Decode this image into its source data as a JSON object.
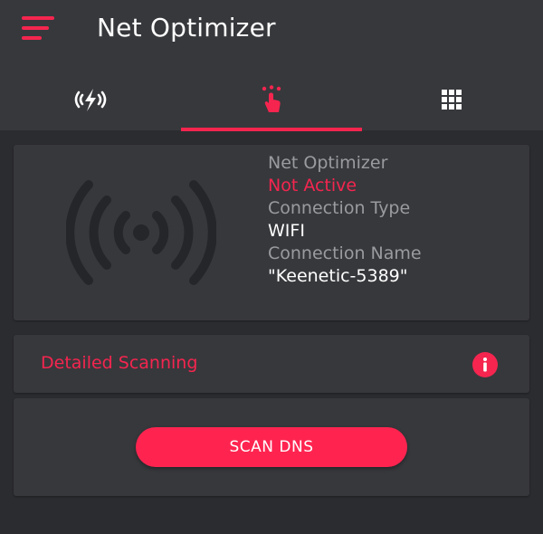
{
  "app": {
    "title": "Net Optimizer",
    "accent_color": "#f5254f"
  },
  "header": {
    "menu_icon": "hamburger-menu-icon",
    "tabs": [
      {
        "icon": "broadcast-lightning-icon",
        "selected": false
      },
      {
        "icon": "touch-tap-icon",
        "selected": true
      },
      {
        "icon": "grid-icon",
        "selected": false
      }
    ]
  },
  "status_card": {
    "icon": "wifi-signal-icon",
    "optimizer_label": "Net Optimizer",
    "optimizer_status": "Not Active",
    "connection_type_label": "Connection Type",
    "connection_type_value": "WIFI",
    "connection_name_label": "Connection Name",
    "connection_name_value": "\"Keenetic-5389\""
  },
  "detailed_scanning": {
    "label": "Detailed Scanning",
    "icon": "info-icon"
  },
  "dns": {
    "button_label": "SCAN DNS"
  }
}
